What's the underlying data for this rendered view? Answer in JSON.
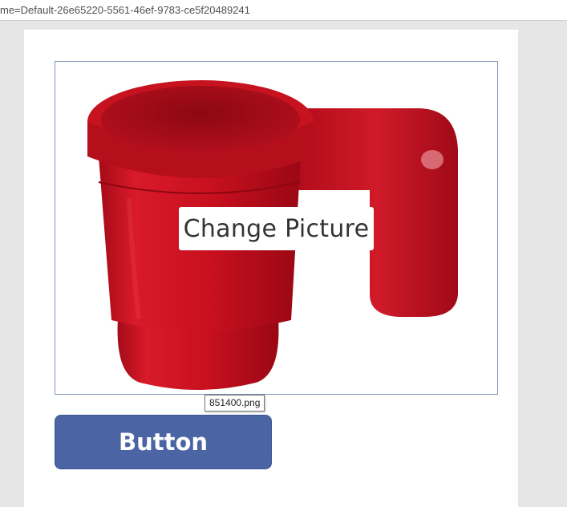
{
  "address_bar": {
    "url_fragment": "me=Default-26e65220-5561-46ef-9783-ce5f20489241"
  },
  "image_control": {
    "overlay_label": "Change Picture",
    "image_subject": "red-mug",
    "tooltip_filename": "851400.png"
  },
  "button": {
    "label": "Button"
  },
  "colors": {
    "button_fill": "#4a64a4",
    "image_border": "#7d93b5",
    "mug_red": "#c8101f"
  }
}
